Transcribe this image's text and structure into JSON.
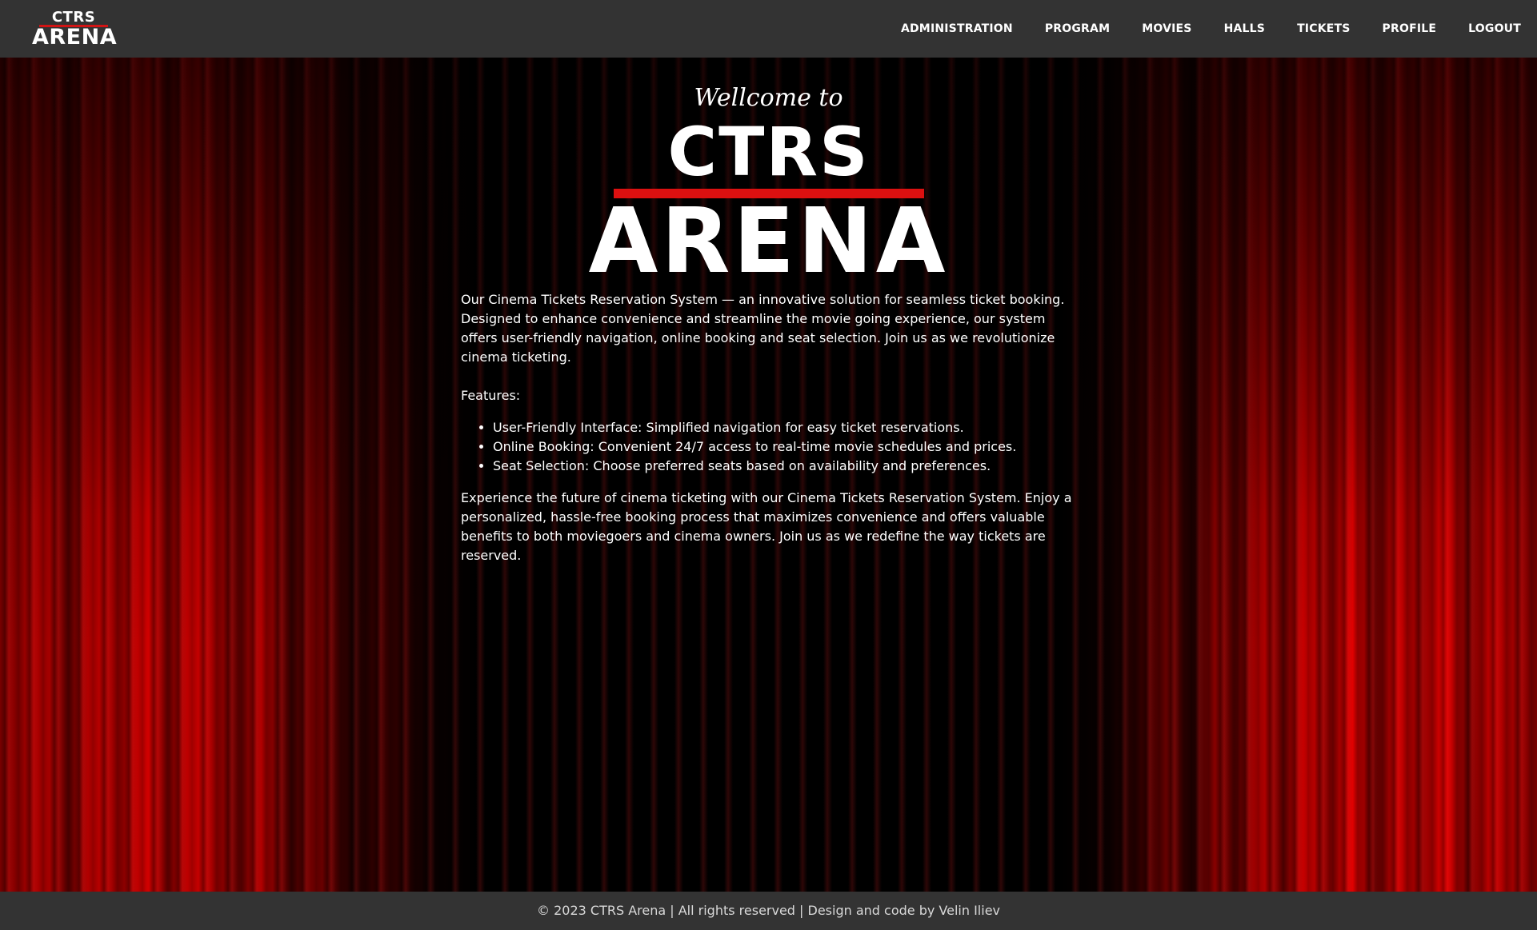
{
  "header": {
    "logo": {
      "line1": "CTRS",
      "line2": "ARENA"
    },
    "nav": [
      {
        "label": "ADMINISTRATION"
      },
      {
        "label": "PROGRAM"
      },
      {
        "label": "MOVIES"
      },
      {
        "label": "HALLS"
      },
      {
        "label": "TICKETS"
      },
      {
        "label": "PROFILE"
      },
      {
        "label": "LOGOUT"
      }
    ]
  },
  "hero": {
    "welcome": "Wellcome to",
    "title_line1": "CTRS",
    "title_line2": "ARENA"
  },
  "content": {
    "intro": "Our Cinema Tickets Reservation System — an innovative solution for seamless ticket booking. Designed to enhance convenience and streamline the movie going experience, our system offers user-friendly navigation, online booking and seat selection. Join us as we revolutionize cinema ticketing.",
    "features_heading": "Features:",
    "features": [
      "User-Friendly Interface: Simplified navigation for easy ticket reservations.",
      "Online Booking: Convenient 24/7 access to real-time movie schedules and prices.",
      "Seat Selection: Choose preferred seats based on availability and preferences."
    ],
    "closing": "Experience the future of cinema ticketing with our Cinema Tickets Reservation System. Enjoy a personalized, hassle-free booking process that maximizes convenience and offers valuable benefits to both moviegoers and cinema owners. Join us as we redefine the way tickets are reserved."
  },
  "footer": {
    "text": "© 2023 CTRS Arena | All rights reserved | Design and code by Velin Iliev"
  },
  "colors": {
    "header_bg": "#333333",
    "accent_red": "#dc1010",
    "text": "#ffffff"
  }
}
